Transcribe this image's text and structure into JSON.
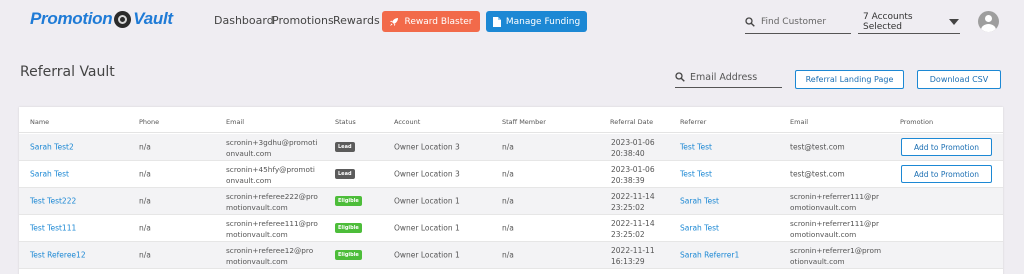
{
  "app": {
    "logo_text_1": "Promotion",
    "logo_text_2": "Vault"
  },
  "nav": {
    "dashboard": "Dashboard",
    "promotions": "Promotions",
    "rewards": "Rewards",
    "reward_blaster": "Reward Blaster",
    "manage_funding": "Manage Funding"
  },
  "header": {
    "find_customer_placeholder": "Find Customer",
    "accounts_selected": "7 Accounts Selected"
  },
  "page": {
    "title": "Referral Vault",
    "email_placeholder": "Email Address",
    "landing_button": "Referral Landing Page",
    "csv_button": "Download CSV"
  },
  "table": {
    "columns": {
      "name": "Name",
      "phone": "Phone",
      "email": "Email",
      "status": "Status",
      "account": "Account",
      "staff": "Staff Member",
      "referral_date": "Referral Date",
      "referrer": "Referrer",
      "referrer_email": "Email",
      "promotion": "Promotion"
    },
    "rows": [
      {
        "name": "Sarah Test2",
        "phone": "n/a",
        "email_1": "scronin+3gdhu@promoti",
        "email_2": "onvault.com",
        "status": "Lead",
        "account": "Owner Location 3",
        "staff": "n/a",
        "date": "2023-01-06",
        "time": "20:38:40",
        "referrer": "Test Test",
        "ref_email_1": "test@test.com",
        "ref_email_2": "",
        "promotion": "Add to Promotion"
      },
      {
        "name": "Sarah Test",
        "phone": "n/a",
        "email_1": "scronin+45hfy@promoti",
        "email_2": "onvault.com",
        "status": "Lead",
        "account": "Owner Location 3",
        "staff": "n/a",
        "date": "2023-01-06",
        "time": "20:38:39",
        "referrer": "Test Test",
        "ref_email_1": "test@test.com",
        "ref_email_2": "",
        "promotion": "Add to Promotion"
      },
      {
        "name": "Test Test222",
        "phone": "n/a",
        "email_1": "scronin+referee222@pro",
        "email_2": "motionvault.com",
        "status": "Eligible",
        "account": "Owner Location 1",
        "staff": "n/a",
        "date": "2022-11-14",
        "time": "23:25:02",
        "referrer": "Sarah Test",
        "ref_email_1": "scronin+referrer111@pr",
        "ref_email_2": "omotionvault.com",
        "promotion": ""
      },
      {
        "name": "Test Test111",
        "phone": "n/a",
        "email_1": "scronin+referee111@pro",
        "email_2": "motionvault.com",
        "status": "Eligible",
        "account": "Owner Location 1",
        "staff": "n/a",
        "date": "2022-11-14",
        "time": "23:25:02",
        "referrer": "Sarah Test",
        "ref_email_1": "scronin+referrer111@pr",
        "ref_email_2": "omotionvault.com",
        "promotion": ""
      },
      {
        "name": "Test Referee12",
        "phone": "n/a",
        "email_1": "scronin+referee12@pro",
        "email_2": "motionvault.com",
        "status": "Eligible",
        "account": "Owner Location 1",
        "staff": "n/a",
        "date": "2022-11-11",
        "time": "16:13:29",
        "referrer": "Sarah Referrer1",
        "ref_email_1": "scronin+referrer1@prom",
        "ref_email_2": "otionvault.com",
        "promotion": ""
      }
    ]
  },
  "colors": {
    "brand_blue": "#1c88d4",
    "reward_orange": "#f26a4a",
    "lead_badge": "#5b5b5b",
    "eligible_badge": "#4dbd3a",
    "background": "#efedf2"
  }
}
